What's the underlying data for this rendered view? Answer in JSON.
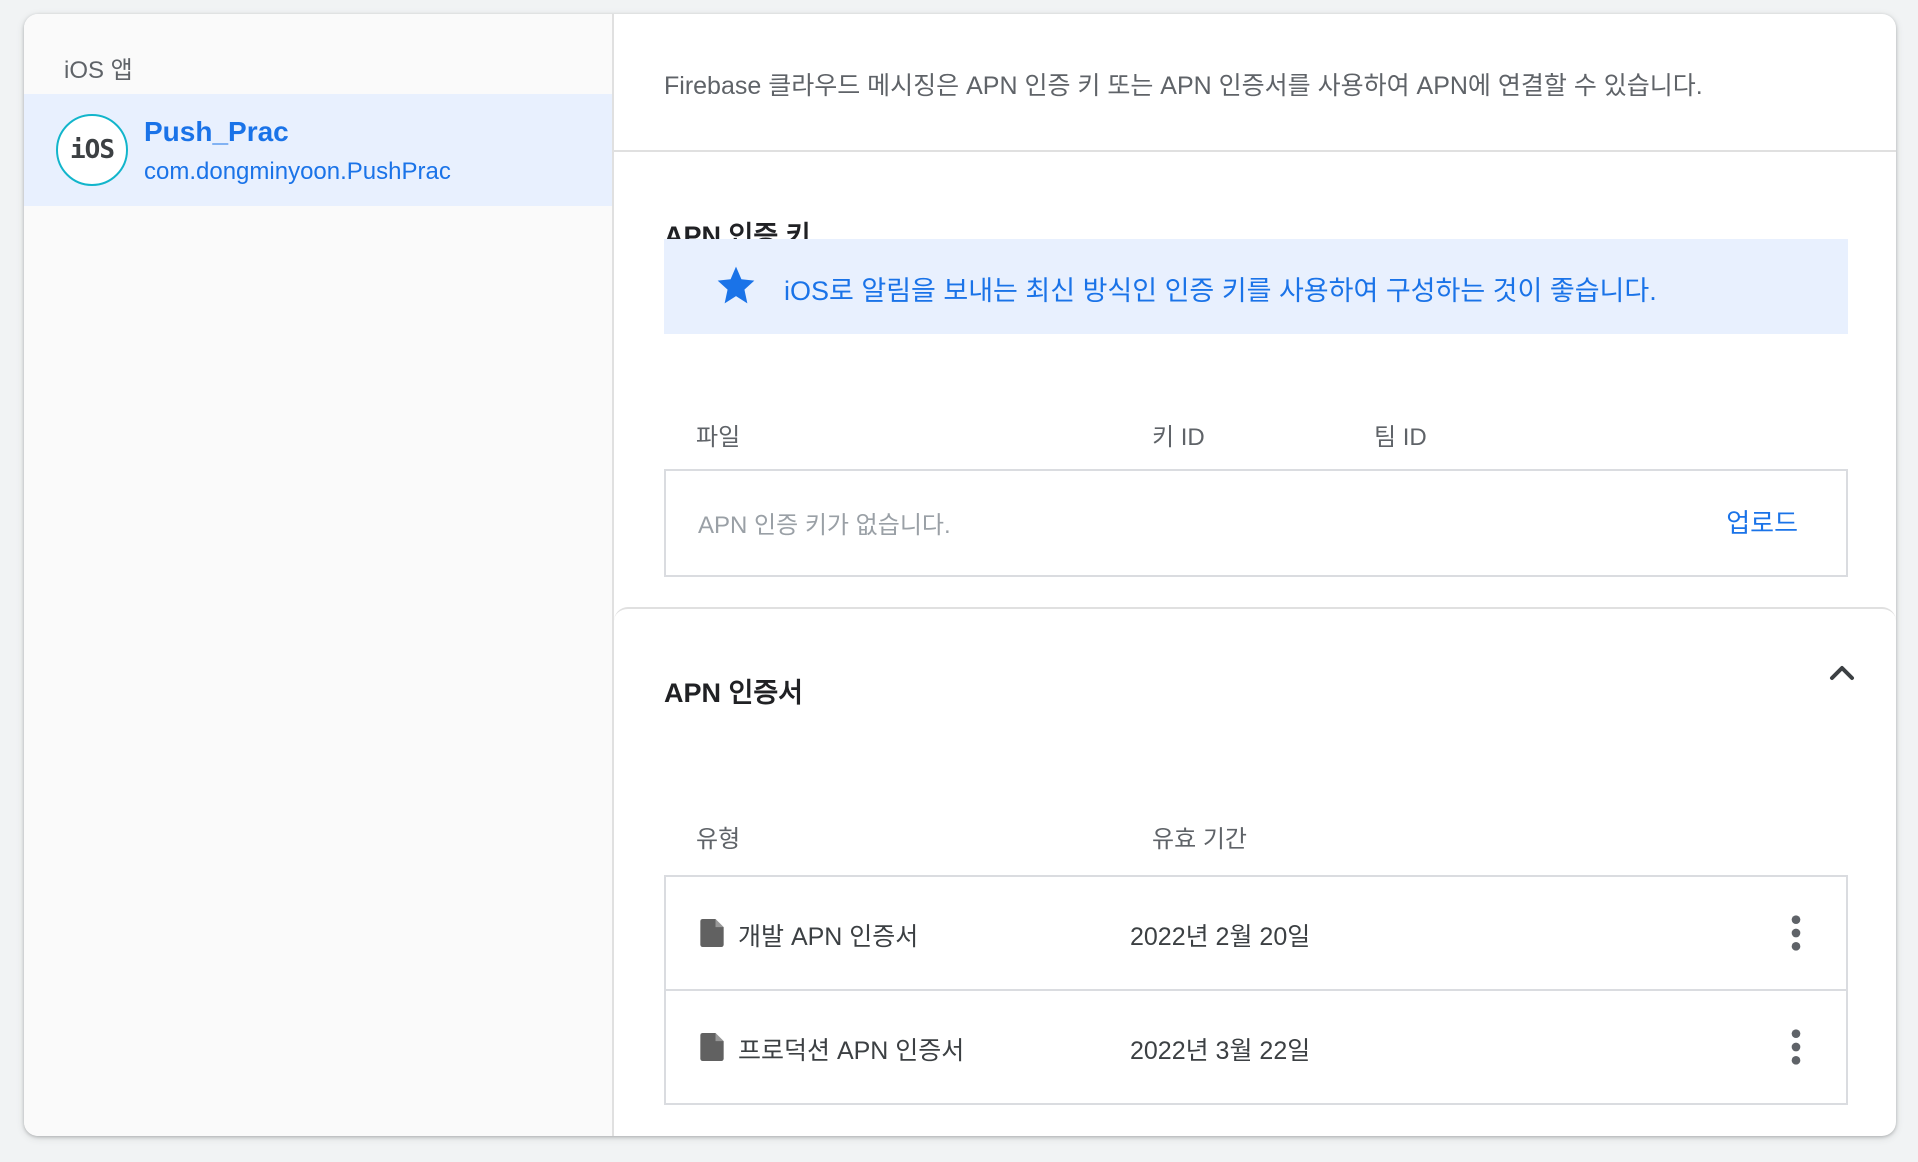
{
  "sidebar": {
    "heading": "iOS 앱",
    "app": {
      "icon_text": "iOS",
      "name": "Push_Prac",
      "bundle_id": "com.dongminyoon.PushPrac"
    }
  },
  "intro": {
    "text": "Firebase 클라우드 메시징은 APN 인증 키 또는 APN 인증서를 사용하여 APN에 연결할 수 있습니다."
  },
  "auth_key": {
    "title": "APN 인증 키",
    "banner_icon": "star-icon",
    "banner_text": "iOS로 알림을 보내는 최신 방식인 인증 키를 사용하여 구성하는 것이 좋습니다.",
    "columns": [
      "파일",
      "키 ID",
      "팀 ID"
    ],
    "empty_text": "APN 인증 키가 없습니다.",
    "upload_label": "업로드"
  },
  "certificates": {
    "title": "APN 인증서",
    "collapse_icon": "chevron-up-icon",
    "columns": [
      "유형",
      "유효 기간"
    ],
    "rows": [
      {
        "type": "개발 APN 인증서",
        "expiry": "2022년 2월 20일",
        "icon": "file-icon"
      },
      {
        "type": "프로덕션 APN 인증서",
        "expiry": "2022년 3월 22일",
        "icon": "file-icon"
      }
    ]
  },
  "colors": {
    "accent": "#1a73e8",
    "selected_bg": "#e8f0fe",
    "avatar_ring": "#12b5cb"
  }
}
